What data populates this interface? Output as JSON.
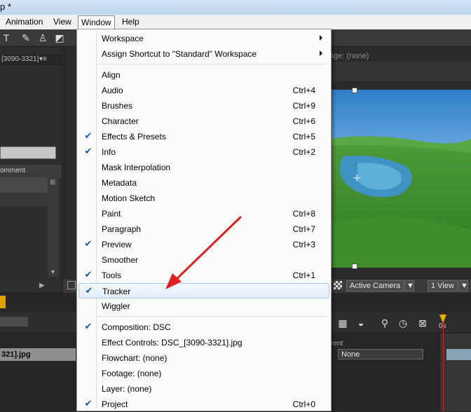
{
  "titlebar": {
    "text": "p *"
  },
  "menubar": {
    "items": [
      "Animation",
      "View",
      "Window",
      "Help"
    ]
  },
  "left_panel": {
    "header": "[3090-3321]",
    "col_header": "omment"
  },
  "composition": {
    "footage_tab": "age: (none)"
  },
  "viewer": {
    "camera": "Active Camera",
    "view": "1 View"
  },
  "timeline": {
    "layer_name": "321].jpg",
    "parent_col": "rent",
    "parent_value": "None",
    "time_label": "0s"
  },
  "menu": {
    "items": [
      {
        "label": "Workspace",
        "shortcut": "",
        "checked": false,
        "submenu": true
      },
      {
        "label": "Assign Shortcut to \"Standard\" Workspace",
        "shortcut": "",
        "checked": false,
        "submenu": true
      },
      {
        "label": "Align",
        "shortcut": "",
        "checked": false
      },
      {
        "label": "Audio",
        "shortcut": "Ctrl+4",
        "checked": false
      },
      {
        "label": "Brushes",
        "shortcut": "Ctrl+9",
        "checked": false
      },
      {
        "label": "Character",
        "shortcut": "Ctrl+6",
        "checked": false
      },
      {
        "label": "Effects & Presets",
        "shortcut": "Ctrl+5",
        "checked": true
      },
      {
        "label": "Info",
        "shortcut": "Ctrl+2",
        "checked": true
      },
      {
        "label": "Mask Interpolation",
        "shortcut": "",
        "checked": false
      },
      {
        "label": "Metadata",
        "shortcut": "",
        "checked": false
      },
      {
        "label": "Motion Sketch",
        "shortcut": "",
        "checked": false
      },
      {
        "label": "Paint",
        "shortcut": "Ctrl+8",
        "checked": false
      },
      {
        "label": "Paragraph",
        "shortcut": "Ctrl+7",
        "checked": false
      },
      {
        "label": "Preview",
        "shortcut": "Ctrl+3",
        "checked": true
      },
      {
        "label": "Smoother",
        "shortcut": "",
        "checked": false
      },
      {
        "label": "Tools",
        "shortcut": "Ctrl+1",
        "checked": true
      },
      {
        "label": "Tracker",
        "shortcut": "",
        "checked": true,
        "highlighted": true
      },
      {
        "label": "Wiggler",
        "shortcut": "",
        "checked": false
      },
      {
        "label": "Composition: DSC",
        "shortcut": "",
        "checked": true
      },
      {
        "label": "Effect Controls: DSC_[3090-3321].jpg",
        "shortcut": "",
        "checked": false
      },
      {
        "label": "Flowchart: (none)",
        "shortcut": "",
        "checked": false
      },
      {
        "label": "Footage: (none)",
        "shortcut": "",
        "checked": false
      },
      {
        "label": "Layer: (none)",
        "shortcut": "",
        "checked": false
      },
      {
        "label": "Project",
        "shortcut": "Ctrl+0",
        "checked": true
      }
    ],
    "check_glyph": "✔"
  },
  "colors": {
    "menu_bg": "#fbfbfb",
    "highlight_border": "#a8c8ec",
    "annotation_arrow": "#e02020",
    "check": "#1a57a8"
  }
}
